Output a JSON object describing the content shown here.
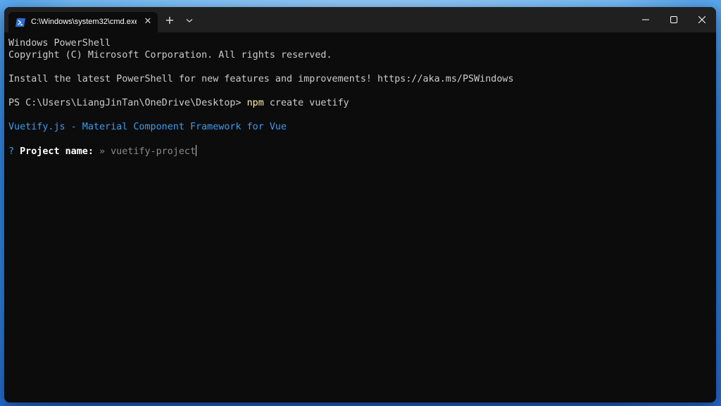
{
  "window": {
    "tab_title": "C:\\Windows\\system32\\cmd.exe",
    "tab_icon": "powershell-icon",
    "new_tab_label": "+",
    "close_tab_label": "✕"
  },
  "terminal": {
    "line1": "Windows PowerShell",
    "line2": "Copyright (C) Microsoft Corporation. All rights reserved.",
    "line3": "Install the latest PowerShell for new features and improvements! https://aka.ms/PSWindows",
    "prompt": "PS C:\\Users\\LiangJinTan\\OneDrive\\Desktop> ",
    "command_name": "npm",
    "command_args": " create vuetify",
    "vuetify_banner": "Vuetify.js - Material Component Framework for Vue",
    "question_mark": "?",
    "question_label": " Project name: ",
    "arrow": "»",
    "default_value": " vuetify-project"
  },
  "colors": {
    "terminal_bg": "#0c0c0c",
    "titlebar_bg": "#202020",
    "text": "#cccccc",
    "command": "#f9f1a5",
    "accent_blue": "#3b9cf0"
  }
}
